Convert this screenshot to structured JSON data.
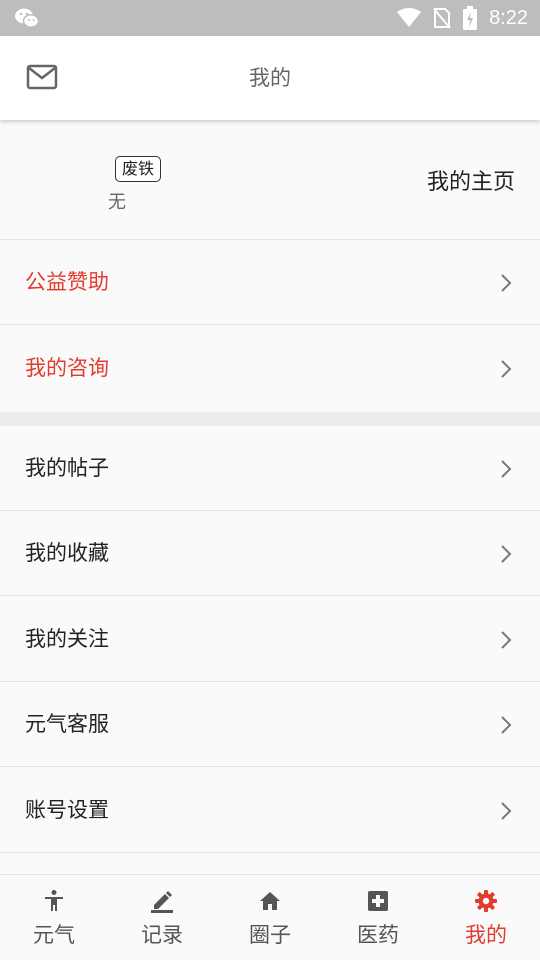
{
  "status_bar": {
    "time": "8:22"
  },
  "header": {
    "title": "我的"
  },
  "profile": {
    "badge": "废铁",
    "nickname": "无",
    "homepage_link": "我的主页"
  },
  "menu": [
    {
      "label": "公益赞助",
      "highlight": true
    },
    {
      "label": "我的咨询",
      "highlight": true
    },
    {
      "label": "我的帖子",
      "highlight": false
    },
    {
      "label": "我的收藏",
      "highlight": false
    },
    {
      "label": "我的关注",
      "highlight": false
    },
    {
      "label": "元气客服",
      "highlight": false
    },
    {
      "label": "账号设置",
      "highlight": false
    }
  ],
  "tabs": [
    {
      "label": "元气",
      "icon": "accessibility-icon"
    },
    {
      "label": "记录",
      "icon": "pen-icon"
    },
    {
      "label": "圈子",
      "icon": "home-icon"
    },
    {
      "label": "医药",
      "icon": "medical-plus-icon"
    },
    {
      "label": "我的",
      "icon": "gear-icon",
      "active": true
    }
  ],
  "colors": {
    "accent": "#e33b2e",
    "statusbar": "#bdbdbd",
    "text": "#222222"
  }
}
